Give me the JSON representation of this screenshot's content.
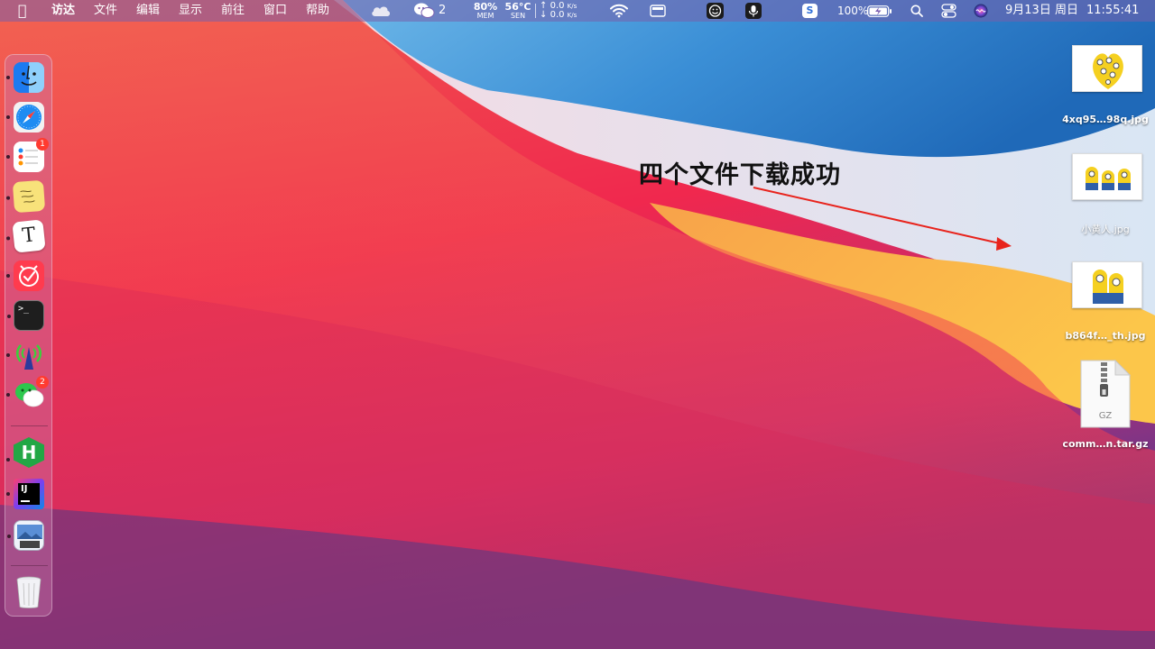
{
  "menubar": {
    "app_name": "访达",
    "menus": [
      "文件",
      "编辑",
      "显示",
      "前往",
      "窗口",
      "帮助"
    ],
    "wechat_count": "2",
    "mem_percent": "80%",
    "mem_label": "MEM",
    "cpu_temp": "56°C",
    "cpu_label": "SEN",
    "net_up": "0.0",
    "net_down": "0.0",
    "net_unit": "K/s",
    "net_up_arrow": "↑",
    "net_down_arrow": "↓",
    "sogou_label": "S",
    "battery_percent": "100%",
    "date": "9月13日 周日",
    "time": "11:55:41"
  },
  "dock": {
    "items": [
      {
        "name": "finder-icon",
        "running": true
      },
      {
        "name": "safari-icon",
        "running": true
      },
      {
        "name": "reminders-icon",
        "running": true,
        "badge": "1"
      },
      {
        "name": "stickies-icon",
        "running": true
      },
      {
        "name": "typora-icon",
        "running": true,
        "glyph": "T"
      },
      {
        "name": "clock-app-icon",
        "running": true
      },
      {
        "name": "terminal-icon",
        "running": true,
        "glyph": ">_"
      },
      {
        "name": "network-radar-icon",
        "running": true
      },
      {
        "name": "wechat-icon",
        "running": true,
        "badge": "2"
      },
      {
        "name": "hbuilder-icon",
        "running": true,
        "glyph": "H"
      },
      {
        "name": "intellij-idea-icon",
        "running": true,
        "glyph": "IJ"
      },
      {
        "name": "preview-icon",
        "running": true
      },
      {
        "name": "trash-icon",
        "running": false
      }
    ]
  },
  "desktop_files": [
    {
      "name": "4xq95…98q.jpg",
      "type": "jpg"
    },
    {
      "name": "小黄人.jpg",
      "type": "jpg"
    },
    {
      "name": "b864f…_th.jpg",
      "type": "jpg"
    },
    {
      "name": "comm…n.tar.gz",
      "type": "gz",
      "badge": "GZ"
    }
  ],
  "annotation": {
    "text": "四个文件下载成功",
    "arrow_color": "#e8231c"
  },
  "colors": {
    "menubar_bg": "#7a5fb0",
    "badge_red": "#ff3b30"
  }
}
